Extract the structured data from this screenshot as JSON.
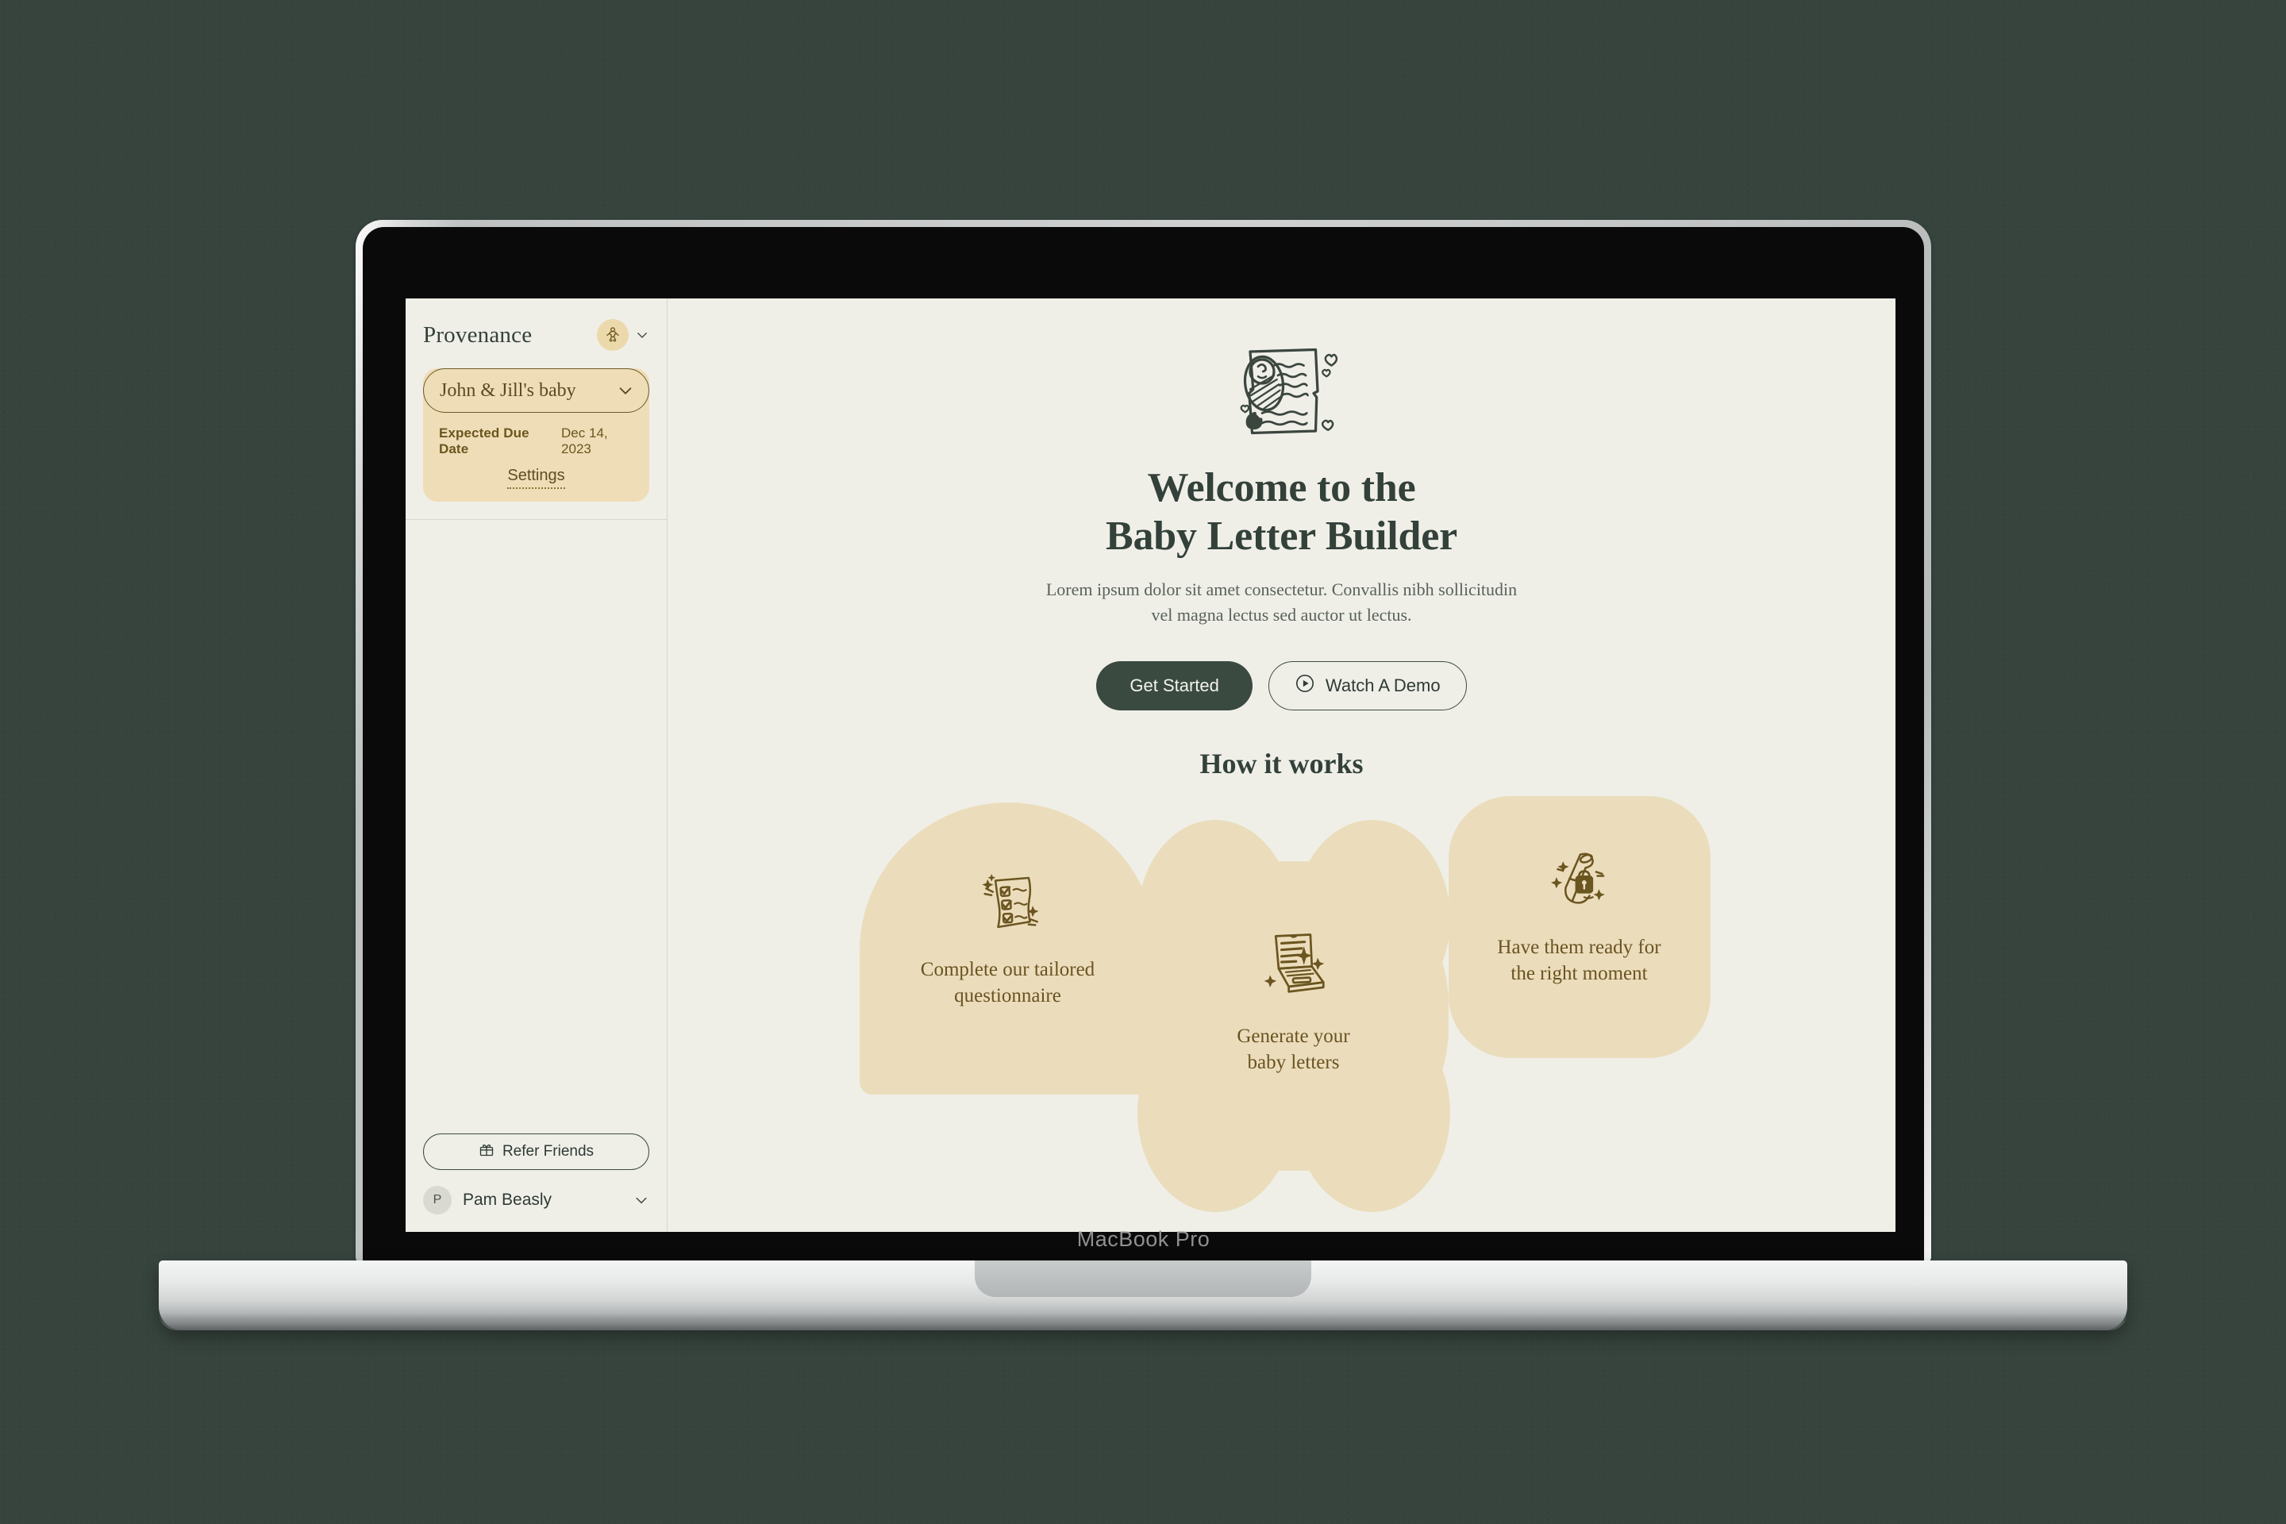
{
  "device": {
    "bezel_label": "MacBook Pro"
  },
  "colors": {
    "backdrop_green": "#37443E",
    "screen_bg": "#EFEFE8",
    "accent_green": "#3A4A40",
    "card_tan": "#EBDDBC",
    "sidebar_card_tan": "#EFDDB7",
    "brand_text": "#33413A",
    "tan_text": "#6A5321"
  },
  "sidebar": {
    "brand": "Provenance",
    "brand_badge_icon": "baby-icon",
    "brand_chevron_icon": "chevron-down-icon",
    "project": {
      "name": "John & Jill's baby",
      "chevron_icon": "chevron-down-icon",
      "due_label": "Expected Due Date",
      "due_value": "Dec 14, 2023",
      "settings_label": "Settings"
    },
    "footer": {
      "refer_label": "Refer Friends",
      "refer_icon": "gift-icon",
      "user_initial": "P",
      "user_name": "Pam Beasly",
      "user_chevron_icon": "chevron-down-icon"
    }
  },
  "main": {
    "hero_icon": "baby-letter-illustration",
    "title_line1": "Welcome to the",
    "title_line2": "Baby Letter Builder",
    "subtitle": "Lorem ipsum dolor sit amet consectetur. Convallis nibh sollicitudin vel magna lectus sed auctor ut lectus.",
    "primary_cta": "Get Started",
    "secondary_cta": "Watch A Demo",
    "secondary_cta_icon": "play-circle-icon",
    "how_it_works_title": "How it works",
    "steps": [
      {
        "label_line1": "Complete our tailored",
        "label_line2": "questionnaire",
        "icon": "checklist-illustration",
        "shape": "arch"
      },
      {
        "label_line1": "Generate your",
        "label_line2": "baby letters",
        "icon": "laptop-illustration",
        "shape": "clover"
      },
      {
        "label_line1": "Have them ready for",
        "label_line2": "the right moment",
        "icon": "locked-scroll-illustration",
        "shape": "squircle"
      }
    ]
  }
}
